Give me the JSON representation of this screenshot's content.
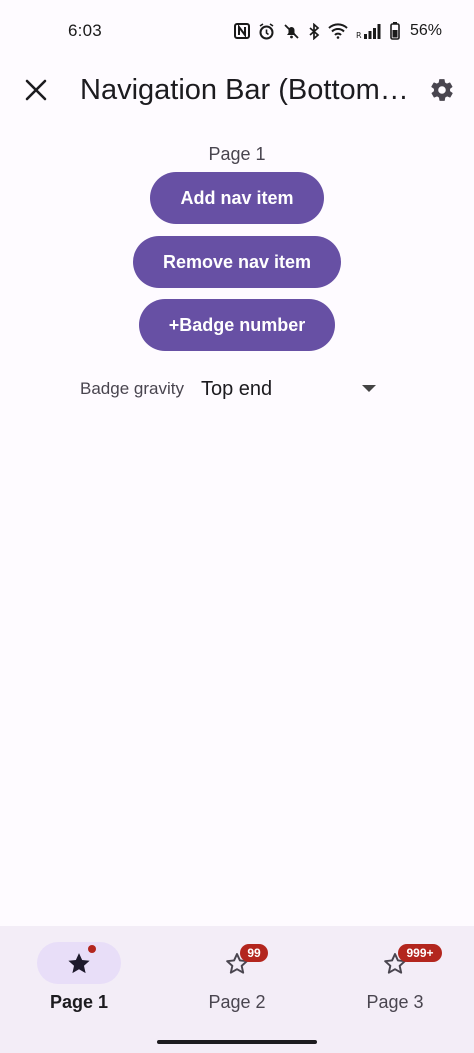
{
  "status_bar": {
    "time": "6:03",
    "battery_percent": "56%",
    "icons": [
      "nfc-icon",
      "alarm-icon",
      "mute-icon",
      "bluetooth-icon",
      "wifi-icon",
      "signal-icon",
      "battery-icon"
    ]
  },
  "app_bar": {
    "title": "Navigation Bar (Bottom…",
    "close_icon": "close-icon",
    "settings_icon": "gear-icon"
  },
  "content": {
    "page_label": "Page 1",
    "add_nav_item": "Add nav item",
    "remove_nav_item": "Remove nav item",
    "add_badge_number": "+Badge number",
    "badge_gravity_label": "Badge gravity",
    "badge_gravity_value": "Top end"
  },
  "bottom_nav": {
    "items": [
      {
        "label": "Page 1",
        "icon": "star-filled-icon",
        "selected": true,
        "badge": ""
      },
      {
        "label": "Page 2",
        "icon": "star-outline-icon",
        "selected": false,
        "badge": "99"
      },
      {
        "label": "Page 3",
        "icon": "star-outline-icon",
        "selected": false,
        "badge": "999+"
      }
    ]
  },
  "colors": {
    "primary": "#6750a4",
    "background": "#fefbff",
    "nav_background": "#f3edf7",
    "indicator": "#e8def8",
    "badge": "#b3261e"
  }
}
